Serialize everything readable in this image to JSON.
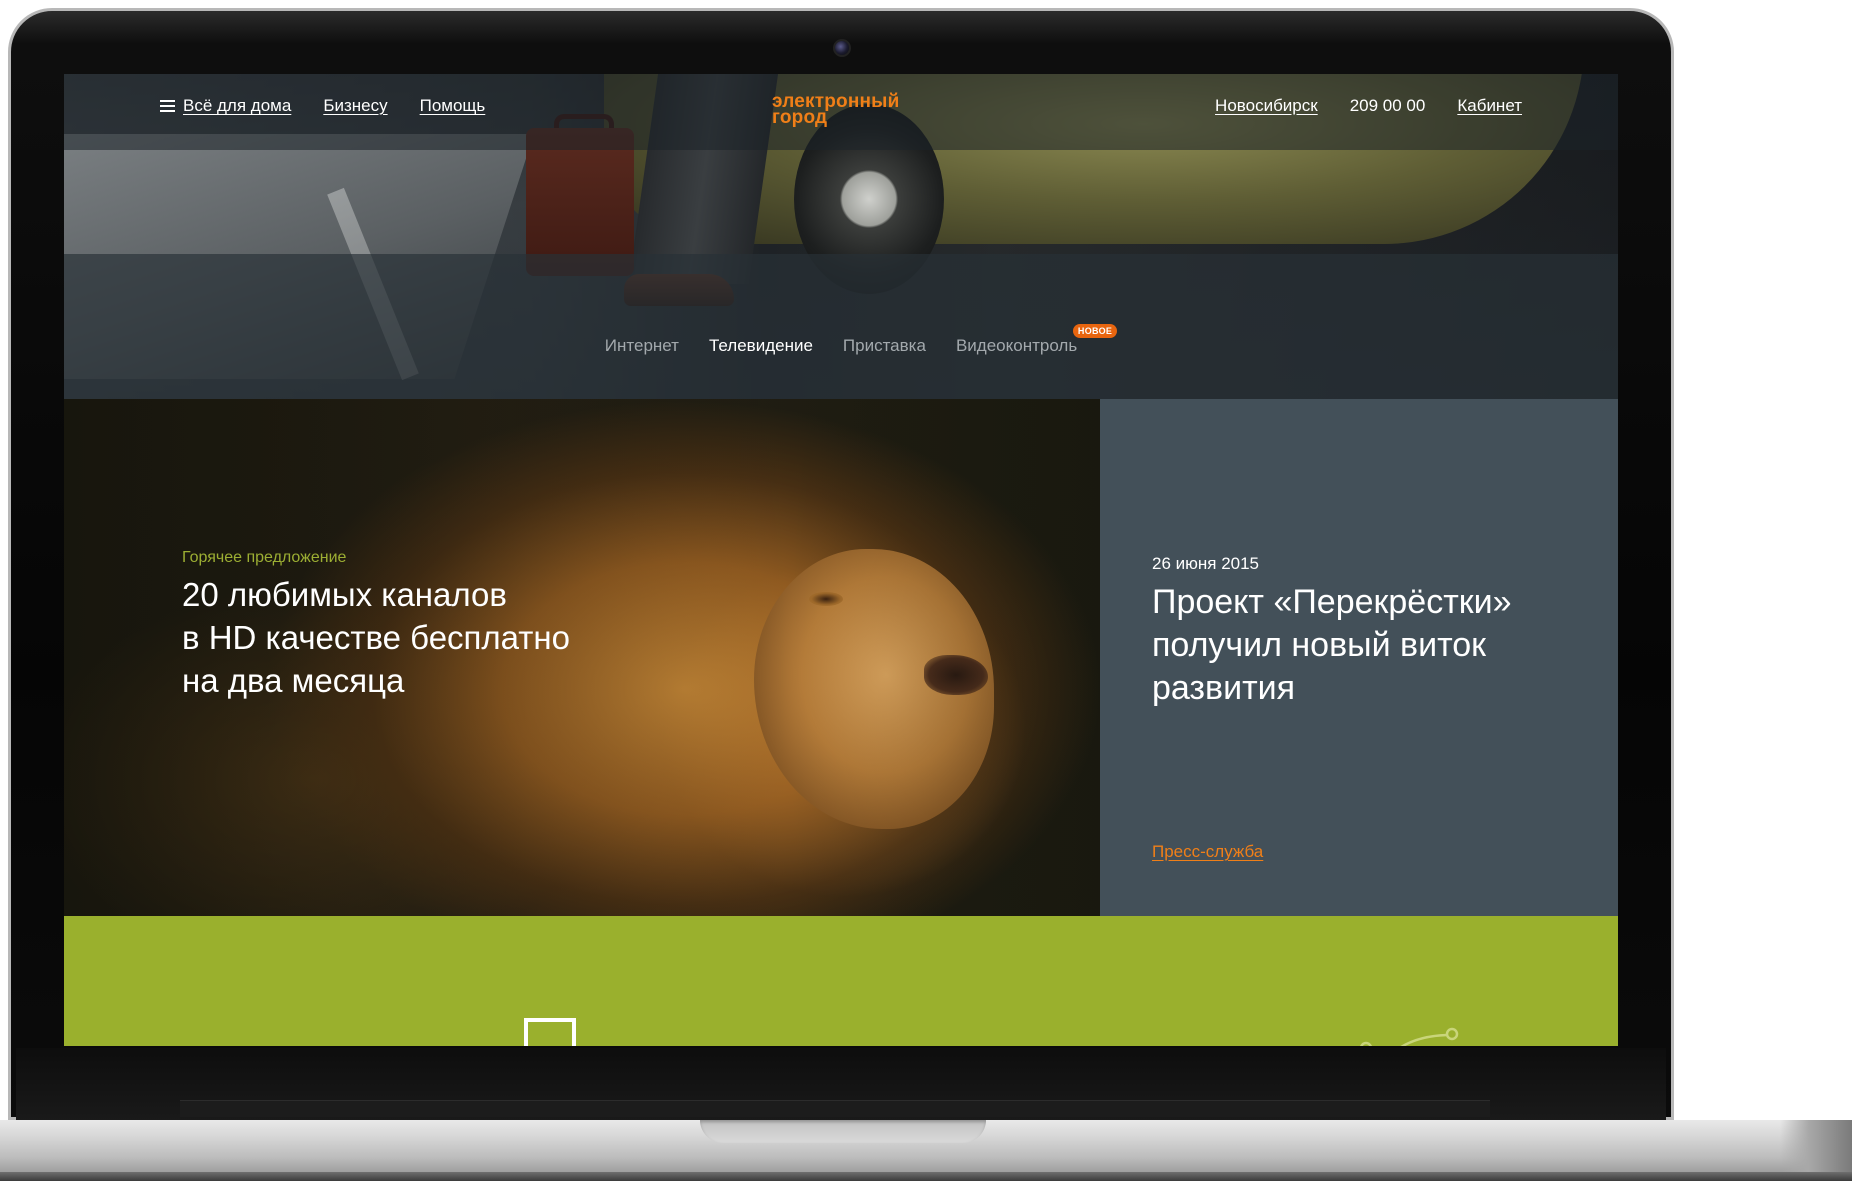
{
  "topnav": {
    "menu_items": [
      "Всё для дома",
      "Бизнесу",
      "Помощь"
    ],
    "logo_line1": "электронный",
    "logo_line2": "город",
    "city": "Новосибирск",
    "phone": "209 00 00",
    "cabinet": "Кабинет"
  },
  "subnav": {
    "items": [
      "Интернет",
      "Телевидение",
      "Приставка",
      "Видеоконтроль"
    ],
    "active": "Телевидение",
    "badge": "НОВОЕ"
  },
  "promo": {
    "eyebrow": "Горячее предложение",
    "title_lines": [
      "20 любимых каналов",
      "в HD качестве бесплатно",
      "на два месяца"
    ]
  },
  "news": {
    "date": "26 июня 2015",
    "title_lines": [
      "Проект «Перекрёстки»",
      "получил новый виток",
      "развития"
    ],
    "link": "Пресс-служба"
  },
  "colors": {
    "accent_orange": "#f07f18",
    "news_panel": "#435059",
    "green_band": "#9ab02d",
    "eyebrow_green": "#9cae33"
  },
  "icons": {
    "menu": "hamburger-icon",
    "tv": "tv-icon",
    "graph": "graph-icon"
  }
}
